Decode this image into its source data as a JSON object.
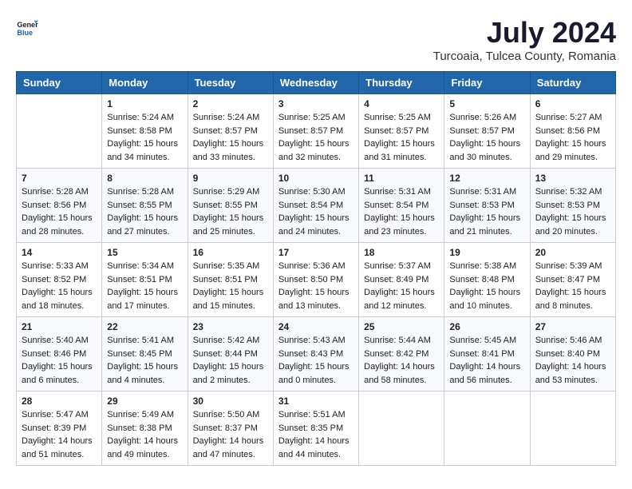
{
  "logo": {
    "text_general": "General",
    "text_blue": "Blue"
  },
  "title": "July 2024",
  "subtitle": "Turcoaia, Tulcea County, Romania",
  "days_header": [
    "Sunday",
    "Monday",
    "Tuesday",
    "Wednesday",
    "Thursday",
    "Friday",
    "Saturday"
  ],
  "weeks": [
    [
      {
        "day": "",
        "sunrise": "",
        "sunset": "",
        "daylight": ""
      },
      {
        "day": "1",
        "sunrise": "Sunrise: 5:24 AM",
        "sunset": "Sunset: 8:58 PM",
        "daylight": "Daylight: 15 hours and 34 minutes."
      },
      {
        "day": "2",
        "sunrise": "Sunrise: 5:24 AM",
        "sunset": "Sunset: 8:57 PM",
        "daylight": "Daylight: 15 hours and 33 minutes."
      },
      {
        "day": "3",
        "sunrise": "Sunrise: 5:25 AM",
        "sunset": "Sunset: 8:57 PM",
        "daylight": "Daylight: 15 hours and 32 minutes."
      },
      {
        "day": "4",
        "sunrise": "Sunrise: 5:25 AM",
        "sunset": "Sunset: 8:57 PM",
        "daylight": "Daylight: 15 hours and 31 minutes."
      },
      {
        "day": "5",
        "sunrise": "Sunrise: 5:26 AM",
        "sunset": "Sunset: 8:57 PM",
        "daylight": "Daylight: 15 hours and 30 minutes."
      },
      {
        "day": "6",
        "sunrise": "Sunrise: 5:27 AM",
        "sunset": "Sunset: 8:56 PM",
        "daylight": "Daylight: 15 hours and 29 minutes."
      }
    ],
    [
      {
        "day": "7",
        "sunrise": "Sunrise: 5:28 AM",
        "sunset": "Sunset: 8:56 PM",
        "daylight": "Daylight: 15 hours and 28 minutes."
      },
      {
        "day": "8",
        "sunrise": "Sunrise: 5:28 AM",
        "sunset": "Sunset: 8:55 PM",
        "daylight": "Daylight: 15 hours and 27 minutes."
      },
      {
        "day": "9",
        "sunrise": "Sunrise: 5:29 AM",
        "sunset": "Sunset: 8:55 PM",
        "daylight": "Daylight: 15 hours and 25 minutes."
      },
      {
        "day": "10",
        "sunrise": "Sunrise: 5:30 AM",
        "sunset": "Sunset: 8:54 PM",
        "daylight": "Daylight: 15 hours and 24 minutes."
      },
      {
        "day": "11",
        "sunrise": "Sunrise: 5:31 AM",
        "sunset": "Sunset: 8:54 PM",
        "daylight": "Daylight: 15 hours and 23 minutes."
      },
      {
        "day": "12",
        "sunrise": "Sunrise: 5:31 AM",
        "sunset": "Sunset: 8:53 PM",
        "daylight": "Daylight: 15 hours and 21 minutes."
      },
      {
        "day": "13",
        "sunrise": "Sunrise: 5:32 AM",
        "sunset": "Sunset: 8:53 PM",
        "daylight": "Daylight: 15 hours and 20 minutes."
      }
    ],
    [
      {
        "day": "14",
        "sunrise": "Sunrise: 5:33 AM",
        "sunset": "Sunset: 8:52 PM",
        "daylight": "Daylight: 15 hours and 18 minutes."
      },
      {
        "day": "15",
        "sunrise": "Sunrise: 5:34 AM",
        "sunset": "Sunset: 8:51 PM",
        "daylight": "Daylight: 15 hours and 17 minutes."
      },
      {
        "day": "16",
        "sunrise": "Sunrise: 5:35 AM",
        "sunset": "Sunset: 8:51 PM",
        "daylight": "Daylight: 15 hours and 15 minutes."
      },
      {
        "day": "17",
        "sunrise": "Sunrise: 5:36 AM",
        "sunset": "Sunset: 8:50 PM",
        "daylight": "Daylight: 15 hours and 13 minutes."
      },
      {
        "day": "18",
        "sunrise": "Sunrise: 5:37 AM",
        "sunset": "Sunset: 8:49 PM",
        "daylight": "Daylight: 15 hours and 12 minutes."
      },
      {
        "day": "19",
        "sunrise": "Sunrise: 5:38 AM",
        "sunset": "Sunset: 8:48 PM",
        "daylight": "Daylight: 15 hours and 10 minutes."
      },
      {
        "day": "20",
        "sunrise": "Sunrise: 5:39 AM",
        "sunset": "Sunset: 8:47 PM",
        "daylight": "Daylight: 15 hours and 8 minutes."
      }
    ],
    [
      {
        "day": "21",
        "sunrise": "Sunrise: 5:40 AM",
        "sunset": "Sunset: 8:46 PM",
        "daylight": "Daylight: 15 hours and 6 minutes."
      },
      {
        "day": "22",
        "sunrise": "Sunrise: 5:41 AM",
        "sunset": "Sunset: 8:45 PM",
        "daylight": "Daylight: 15 hours and 4 minutes."
      },
      {
        "day": "23",
        "sunrise": "Sunrise: 5:42 AM",
        "sunset": "Sunset: 8:44 PM",
        "daylight": "Daylight: 15 hours and 2 minutes."
      },
      {
        "day": "24",
        "sunrise": "Sunrise: 5:43 AM",
        "sunset": "Sunset: 8:43 PM",
        "daylight": "Daylight: 15 hours and 0 minutes."
      },
      {
        "day": "25",
        "sunrise": "Sunrise: 5:44 AM",
        "sunset": "Sunset: 8:42 PM",
        "daylight": "Daylight: 14 hours and 58 minutes."
      },
      {
        "day": "26",
        "sunrise": "Sunrise: 5:45 AM",
        "sunset": "Sunset: 8:41 PM",
        "daylight": "Daylight: 14 hours and 56 minutes."
      },
      {
        "day": "27",
        "sunrise": "Sunrise: 5:46 AM",
        "sunset": "Sunset: 8:40 PM",
        "daylight": "Daylight: 14 hours and 53 minutes."
      }
    ],
    [
      {
        "day": "28",
        "sunrise": "Sunrise: 5:47 AM",
        "sunset": "Sunset: 8:39 PM",
        "daylight": "Daylight: 14 hours and 51 minutes."
      },
      {
        "day": "29",
        "sunrise": "Sunrise: 5:49 AM",
        "sunset": "Sunset: 8:38 PM",
        "daylight": "Daylight: 14 hours and 49 minutes."
      },
      {
        "day": "30",
        "sunrise": "Sunrise: 5:50 AM",
        "sunset": "Sunset: 8:37 PM",
        "daylight": "Daylight: 14 hours and 47 minutes."
      },
      {
        "day": "31",
        "sunrise": "Sunrise: 5:51 AM",
        "sunset": "Sunset: 8:35 PM",
        "daylight": "Daylight: 14 hours and 44 minutes."
      },
      {
        "day": "",
        "sunrise": "",
        "sunset": "",
        "daylight": ""
      },
      {
        "day": "",
        "sunrise": "",
        "sunset": "",
        "daylight": ""
      },
      {
        "day": "",
        "sunrise": "",
        "sunset": "",
        "daylight": ""
      }
    ]
  ]
}
